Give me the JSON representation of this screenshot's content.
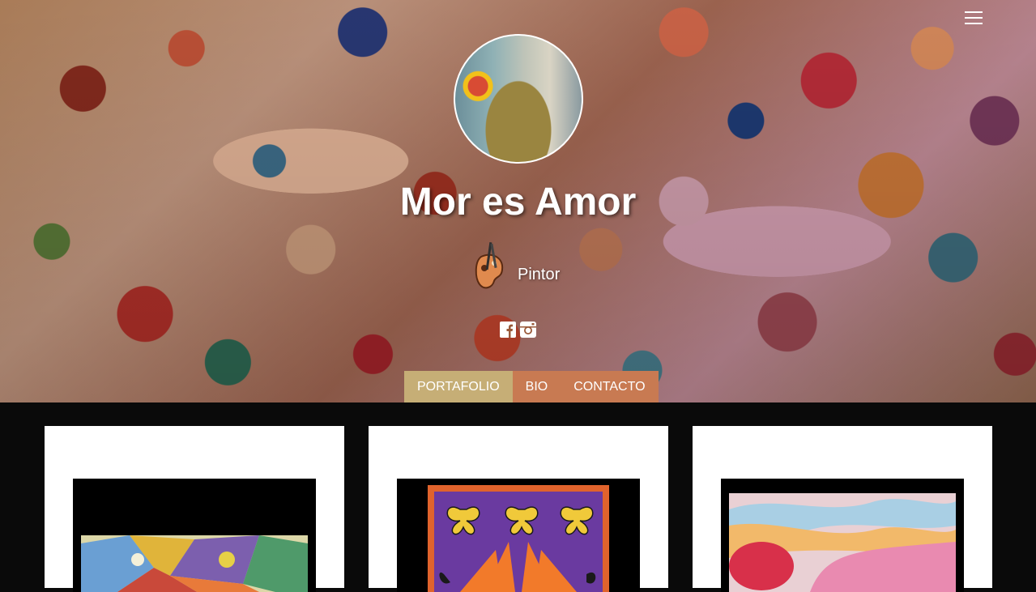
{
  "site": {
    "title": "Mor es Amor",
    "subtitle": "Pintor"
  },
  "header": {
    "menu_icon": "hamburger-menu-icon"
  },
  "social": [
    {
      "name": "facebook",
      "icon": "facebook-icon"
    },
    {
      "name": "instagram",
      "icon": "instagram-icon"
    }
  ],
  "nav": {
    "items": [
      {
        "label": "PORTAFOLIO",
        "active": true
      },
      {
        "label": "BIO",
        "active": false
      },
      {
        "label": "CONTACTO",
        "active": false
      }
    ]
  },
  "colors": {
    "nav_active": "#c6ae76",
    "nav_inactive": "#c87a52",
    "page_background": "#0a0a0a",
    "card_background": "#ffffff"
  },
  "gallery": {
    "items": [
      {
        "name": "painting-geometric"
      },
      {
        "name": "painting-butterflies"
      },
      {
        "name": "painting-pink-abstract"
      }
    ]
  }
}
